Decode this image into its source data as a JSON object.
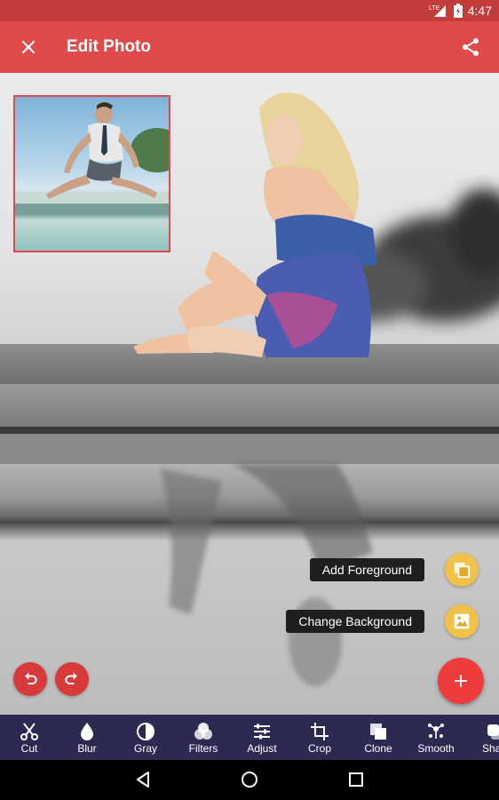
{
  "status_bar": {
    "network": "LTE",
    "time": "4:47"
  },
  "app_bar": {
    "title": "Edit Photo",
    "close_icon": "close-icon",
    "share_icon": "share-icon"
  },
  "editor": {
    "thumbnail": "foreground-photo-thumbnail",
    "undo_icon": "undo-icon",
    "redo_icon": "redo-icon"
  },
  "fab_menu": {
    "add_foreground_label": "Add Foreground",
    "change_background_label": "Change Background",
    "main_fab_icon": "plus-icon"
  },
  "toolbar": {
    "tools": [
      {
        "label": "Cut",
        "icon": "scissors-icon"
      },
      {
        "label": "Blur",
        "icon": "droplet-icon"
      },
      {
        "label": "Gray",
        "icon": "contrast-icon"
      },
      {
        "label": "Filters",
        "icon": "filters-icon"
      },
      {
        "label": "Adjust",
        "icon": "sliders-icon"
      },
      {
        "label": "Crop",
        "icon": "crop-icon"
      },
      {
        "label": "Clone",
        "icon": "clone-icon"
      },
      {
        "label": "Smooth",
        "icon": "smooth-icon"
      },
      {
        "label": "Shad",
        "icon": "shadow-icon"
      }
    ]
  },
  "colors": {
    "status_bar": "#c43c3a",
    "app_bar": "#e04a4a",
    "toolbar": "#2c2a52",
    "fab": "#ee3b3b",
    "mini_fab": "#f0c24a"
  }
}
